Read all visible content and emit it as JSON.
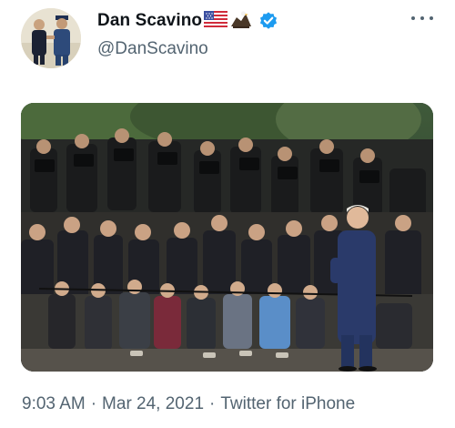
{
  "user": {
    "display_name": "Dan Scavino",
    "handle": "@DanScavino",
    "verified": true,
    "emojis": [
      "us-flag",
      "eagle"
    ]
  },
  "menu": {
    "icon": "more-horizontal-icon"
  },
  "media": {
    "type": "photo",
    "description_icon": "press-photographers-photo"
  },
  "meta": {
    "time": "9:03 AM",
    "separator": "·",
    "date": "Mar 24, 2021",
    "source": "Twitter for iPhone"
  },
  "colors": {
    "text": "#0f1419",
    "secondary": "#536471",
    "verified": "#1d9bf0"
  }
}
